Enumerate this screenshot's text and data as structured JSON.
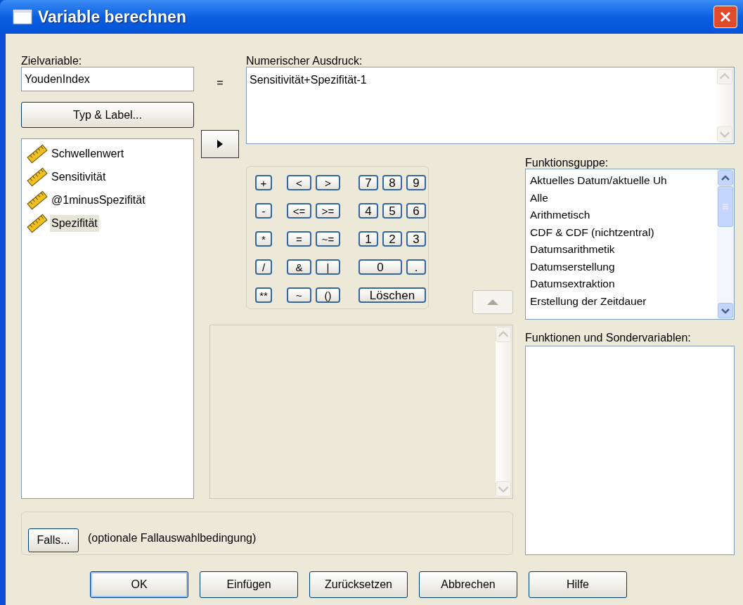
{
  "window": {
    "title": "Variable berechnen"
  },
  "target": {
    "label": "Zielvariable:",
    "value": "YoudenIndex"
  },
  "equals": "=",
  "type_label_button": "Typ & Label...",
  "variables": [
    {
      "label": "Schwellenwert",
      "selected": false
    },
    {
      "label": "Sensitivität",
      "selected": false
    },
    {
      "label": "@1minusSpezifität",
      "selected": false
    },
    {
      "label": "Spezifität",
      "selected": true
    }
  ],
  "expression": {
    "label": "Numerischer Ausdruck:",
    "value": "Sensitivität+Spezifität-1"
  },
  "keypad": {
    "operator_rows": [
      [
        "+",
        "<",
        ">"
      ],
      [
        "-",
        "<=",
        ">="
      ],
      [
        "*",
        "=",
        "~="
      ],
      [
        "/",
        "&",
        "|"
      ],
      [
        "**",
        "~",
        "()"
      ]
    ],
    "digit_rows": [
      [
        {
          "label": "7",
          "kind": "single"
        },
        {
          "label": "8",
          "kind": "single"
        },
        {
          "label": "9",
          "kind": "single"
        }
      ],
      [
        {
          "label": "4",
          "kind": "single"
        },
        {
          "label": "5",
          "kind": "single"
        },
        {
          "label": "6",
          "kind": "single"
        }
      ],
      [
        {
          "label": "1",
          "kind": "single"
        },
        {
          "label": "2",
          "kind": "single"
        },
        {
          "label": "3",
          "kind": "single"
        }
      ],
      [
        {
          "label": "0",
          "kind": "double"
        },
        {
          "label": ".",
          "kind": "single"
        }
      ],
      [
        {
          "label": "Löschen",
          "kind": "triple"
        }
      ]
    ]
  },
  "function_group": {
    "label": "Funktionsguppe:",
    "items": [
      "Aktuelles Datum/aktuelle Uh",
      "Alle",
      "Arithmetisch",
      "CDF & CDF (nichtzentral)",
      "Datumsarithmetik",
      "Datumserstellung",
      "Datumsextraktion",
      "Erstellung der Zeitdauer"
    ]
  },
  "functions": {
    "label": "Funktionen und Sondervariablen:"
  },
  "condition": {
    "button": "Falls...",
    "text": "(optionale Fallauswahlbedingung)"
  },
  "buttons": [
    {
      "label": "OK",
      "default": true
    },
    {
      "label": "Einfügen",
      "default": false
    },
    {
      "label": "Zurücksetzen",
      "default": false
    },
    {
      "label": "Abbrechen",
      "default": false
    },
    {
      "label": "Hilfe",
      "default": false
    }
  ]
}
